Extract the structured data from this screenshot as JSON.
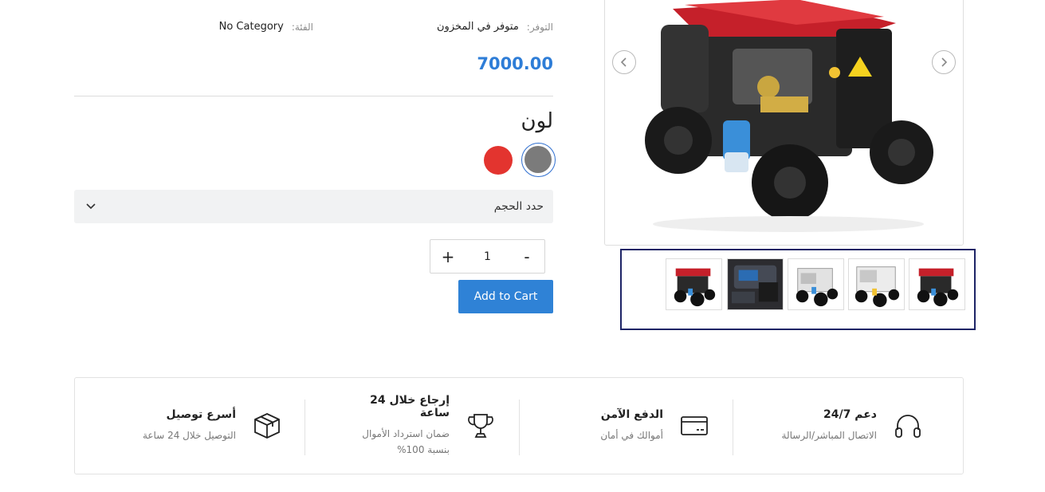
{
  "product": {
    "availability_label": "التوفر:",
    "availability_value": "متوفر في المخزون",
    "category_label": "الفئة:",
    "category_value": "No Category",
    "price": "7000.00"
  },
  "options": {
    "color_title": "لون",
    "colors": [
      {
        "name": "gray",
        "hex": "#7b7b7b",
        "selected": true
      },
      {
        "name": "red",
        "hex": "#e3342f",
        "selected": false
      }
    ],
    "size_placeholder": "حدد الحجم"
  },
  "cart": {
    "quantity": "1",
    "minus_label": "-",
    "plus_label": "+",
    "add_to_cart_label": "Add to Cart"
  },
  "gallery": {
    "thumbnails": [
      "red-pressure-washer",
      "engine-closeup",
      "white-pressure-washer",
      "white-pressure-washer-angle",
      "red-pressure-washer"
    ],
    "accent_color": "#1d2466"
  },
  "features": [
    {
      "icon": "headset-icon",
      "title": "دعم 24/7",
      "subtitle": "الاتصال المباشر/الرسالة"
    },
    {
      "icon": "credit-card-icon",
      "title": "الدفع الآمن",
      "subtitle": "أموالك في أمان"
    },
    {
      "icon": "trophy-icon",
      "title": "إرجاع خلال 24 ساعة",
      "subtitle": "ضمان استرداد الأموال بنسبة 100%"
    },
    {
      "icon": "box-icon",
      "title": "أسرع توصيل",
      "subtitle": "التوصيل خلال 24 ساعة"
    }
  ],
  "colors": {
    "price": "#2e7dd7",
    "button": "#2f82d6",
    "thumb_strip_border": "#1d2466"
  }
}
